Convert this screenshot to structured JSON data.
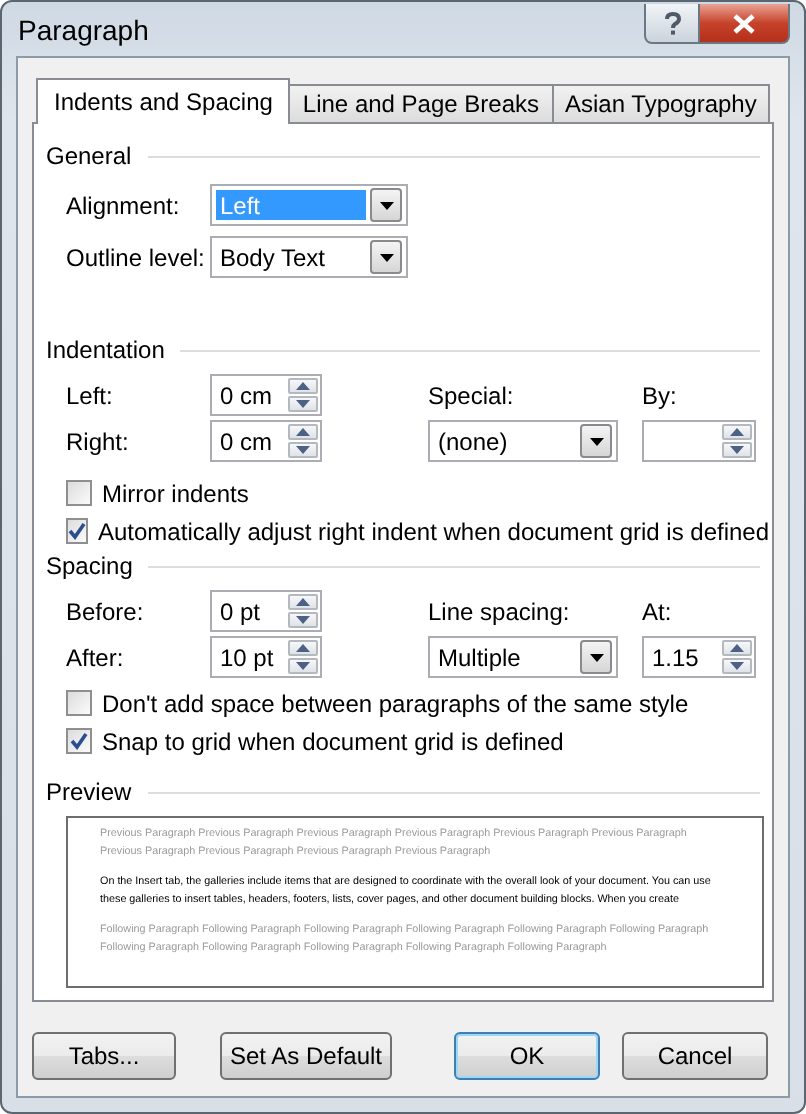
{
  "window": {
    "title": "Paragraph"
  },
  "tabs": [
    {
      "label": "Indents and Spacing",
      "selected": true
    },
    {
      "label": "Line and Page Breaks",
      "selected": false
    },
    {
      "label": "Asian Typography",
      "selected": false
    }
  ],
  "general": {
    "heading": "General",
    "fields": [
      {
        "label": "Alignment:",
        "value": "Left",
        "focused": true
      },
      {
        "label": "Outline level:",
        "value": "Body Text",
        "focused": false
      }
    ]
  },
  "indentation": {
    "heading": "Indentation",
    "fields": [
      {
        "label": "Left:",
        "value": "0 cm"
      },
      {
        "label": "Right:",
        "value": "0 cm"
      }
    ],
    "special": {
      "label": "Special:",
      "value": "(none)"
    },
    "by": {
      "label": "By:"
    },
    "checks": [
      {
        "label": "Mirror indents",
        "checked": false
      },
      {
        "label": "Automatically adjust right indent when document grid is defined",
        "checked": true
      }
    ]
  },
  "spacing": {
    "heading": "Spacing",
    "fields": [
      {
        "label": "Before:",
        "value": "0 pt"
      },
      {
        "label": "After:",
        "value": "10 pt"
      }
    ],
    "line_spacing": {
      "label": "Line spacing:",
      "value": "Multiple"
    },
    "at": {
      "label": "At:",
      "value": "1.15"
    },
    "checks": [
      {
        "label": "Don't add space between paragraphs of the same style",
        "checked": false
      },
      {
        "label": "Snap to grid when document grid is defined",
        "checked": true
      }
    ]
  },
  "preview": {
    "heading": "Preview",
    "previous": "Previous Paragraph Previous Paragraph Previous Paragraph Previous Paragraph Previous Paragraph Previous Paragraph Previous Paragraph Previous Paragraph Previous Paragraph Previous Paragraph",
    "sample": "On the Insert tab, the galleries include items that are designed to coordinate with the overall look of your document. You can use these galleries to insert tables, headers, footers, lists, cover pages, and other document building blocks. When you create",
    "following": "Following Paragraph Following Paragraph Following Paragraph Following Paragraph Following Paragraph Following Paragraph Following Paragraph Following Paragraph Following Paragraph Following Paragraph Following Paragraph"
  },
  "buttons": [
    {
      "label": "Tabs...",
      "default": false
    },
    {
      "label": "Set As Default",
      "default": false
    },
    {
      "label": "OK",
      "default": true
    },
    {
      "label": "Cancel",
      "default": false
    }
  ]
}
